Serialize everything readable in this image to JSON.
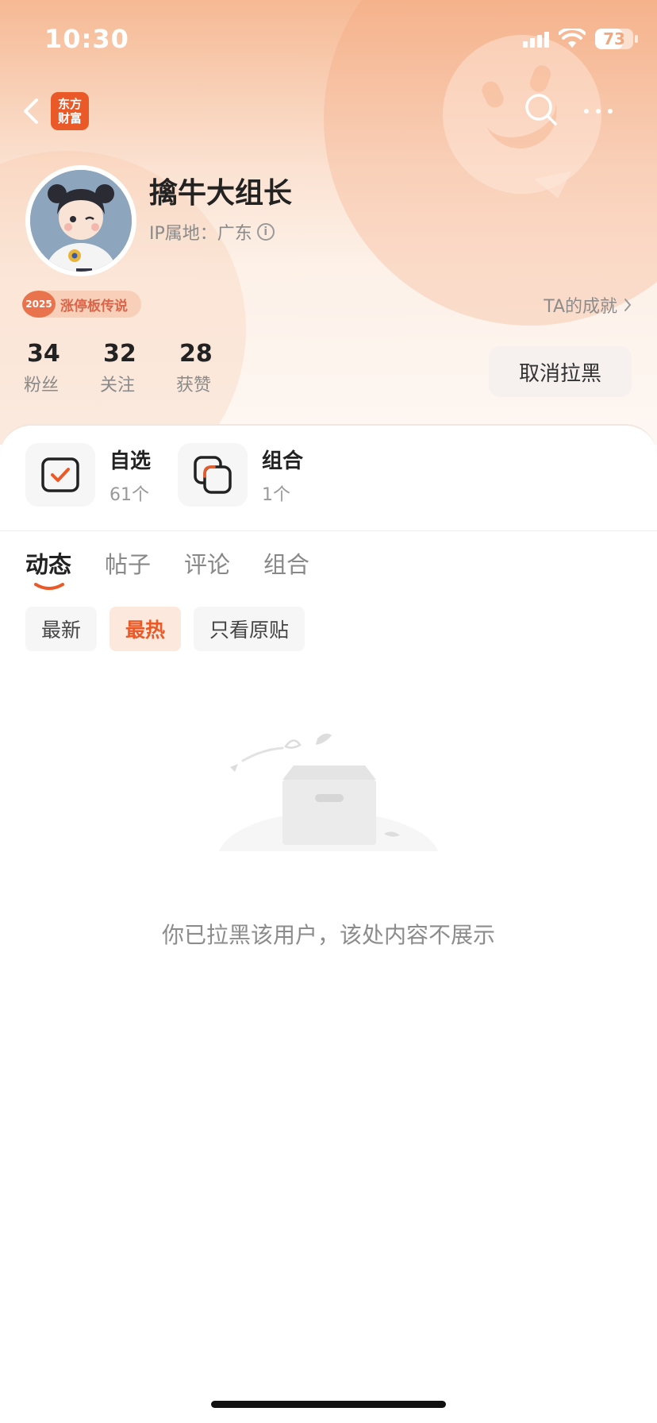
{
  "status_bar": {
    "time": "10:30",
    "battery_level": "73",
    "battery_fraction": 0.73,
    "icons": [
      "signal-icon",
      "wifi-icon",
      "battery-icon"
    ]
  },
  "nav": {
    "back_icon": "chevron-left-icon",
    "app_logo_line1": "东方",
    "app_logo_line2": "财富",
    "search_icon": "search-icon",
    "more_icon": "more-icon"
  },
  "profile": {
    "username": "擒牛大组长",
    "ip_location": "IP属地：广东",
    "badge_year": "2025",
    "badge_label": "涨停板传说",
    "achievements_link": "TA的成就"
  },
  "stats": [
    {
      "value": "34",
      "label": "粉丝"
    },
    {
      "value": "32",
      "label": "关注"
    },
    {
      "value": "28",
      "label": "获赞"
    }
  ],
  "actions": {
    "unblock_label": "取消拉黑"
  },
  "shortcuts": [
    {
      "title": "自选",
      "subtitle": "61个"
    },
    {
      "title": "组合",
      "subtitle": "1个"
    }
  ],
  "tabs": [
    "动态",
    "帖子",
    "评论",
    "组合"
  ],
  "active_tab": "动态",
  "filters": [
    "最新",
    "最热",
    "只看原贴"
  ],
  "active_filter": "最热",
  "empty_state": {
    "message": "你已拉黑该用户，该处内容不展示"
  },
  "colors": {
    "accent": "#ea5a28",
    "header_gradient_top": "#f6b994",
    "text_primary": "#222222",
    "text_secondary": "#8a8a8a"
  }
}
